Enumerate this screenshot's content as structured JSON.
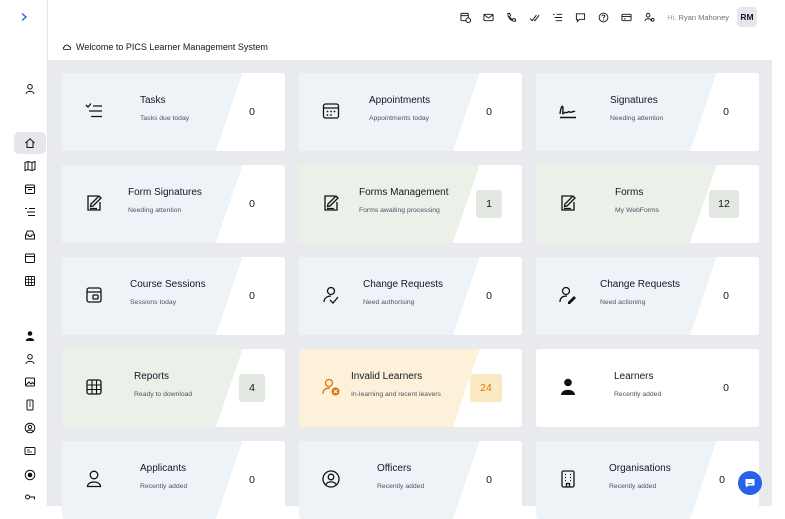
{
  "header": {
    "greeting": "Hi,",
    "user_name": "Ryan Mahoney",
    "initials": "RM"
  },
  "welcome": "Welcome to PICS Learner Management System",
  "colors": {
    "accent": "#2563eb",
    "card_blue": "#eef3f8",
    "card_green": "#ebf0e9",
    "card_orange": "#fdf1d9",
    "warning_text": "#d97706"
  },
  "topbar_icons": [
    "calendar-clock-icon",
    "mail-icon",
    "phone-icon",
    "check-icon",
    "list-icon",
    "chat-icon",
    "help-icon",
    "card-icon",
    "users-icon"
  ],
  "sidebar_icons": [
    "user-icon",
    "home-icon",
    "map-icon",
    "calendar-icon",
    "list-icon",
    "inbox-icon",
    "calendar-icon",
    "table-icon",
    "person-filled-icon",
    "user-icon",
    "image-icon",
    "device-icon",
    "user-circle-icon",
    "id-card-icon",
    "globe-icon",
    "key-icon"
  ],
  "cards": [
    {
      "title": "Tasks",
      "subtitle": "Tasks due today",
      "count": "0",
      "icon": "tasks-icon"
    },
    {
      "title": "Appointments",
      "subtitle": "Appointments today",
      "count": "0",
      "icon": "calendar-icon"
    },
    {
      "title": "Signatures",
      "subtitle": "Needing attention",
      "count": "0",
      "icon": "signature-icon"
    },
    {
      "title": "Form Signatures",
      "subtitle": "Needing attention",
      "count": "0",
      "icon": "form-pen-icon"
    },
    {
      "title": "Forms Management",
      "subtitle": "Forms awaiting processing",
      "count": "1",
      "icon": "form-pen-icon"
    },
    {
      "title": "Forms",
      "subtitle": "My WebForms",
      "count": "12",
      "icon": "form-pen-icon"
    },
    {
      "title": "Course Sessions",
      "subtitle": "Sessions today",
      "count": "0",
      "icon": "session-icon"
    },
    {
      "title": "Change Requests",
      "subtitle": "Need authorising",
      "count": "0",
      "icon": "user-check-icon"
    },
    {
      "title": "Change Requests",
      "subtitle": "Need actioning",
      "count": "0",
      "icon": "user-edit-icon"
    },
    {
      "title": "Reports",
      "subtitle": "Ready to download",
      "count": "4",
      "icon": "table-icon"
    },
    {
      "title": "Invalid Learners",
      "subtitle": "In-learning and recent leavers",
      "count": "24",
      "icon": "user-warning-icon"
    },
    {
      "title": "Learners",
      "subtitle": "Recently added",
      "count": "0",
      "icon": "person-filled-icon"
    },
    {
      "title": "Applicants",
      "subtitle": "Recently added",
      "count": "0",
      "icon": "user-icon"
    },
    {
      "title": "Officers",
      "subtitle": "Recently added",
      "count": "0",
      "icon": "user-circle-icon"
    },
    {
      "title": "Organisations",
      "subtitle": "Recently added",
      "count": "0",
      "icon": "building-icon"
    }
  ]
}
